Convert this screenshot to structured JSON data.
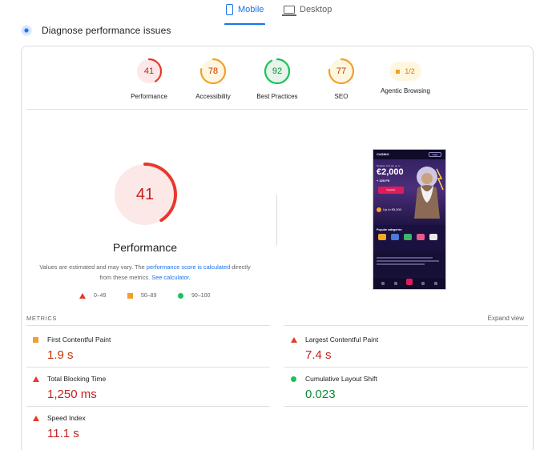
{
  "tabs": [
    {
      "label": "Mobile",
      "icon": "phone-icon",
      "active": true
    },
    {
      "label": "Desktop",
      "icon": "desktop-icon",
      "active": false
    }
  ],
  "diagnose": {
    "title": "Diagnose performance issues"
  },
  "scores": [
    {
      "label": "Performance",
      "value": "41",
      "color": "#e8382e",
      "fill": 0.41
    },
    {
      "label": "Accessibility",
      "value": "78",
      "color": "#f0a030",
      "fill": 0.78
    },
    {
      "label": "Best Practices",
      "value": "92",
      "color": "#19c25a",
      "fill": 0.92
    },
    {
      "label": "SEO",
      "value": "77",
      "color": "#f0a030",
      "fill": 0.77
    },
    {
      "label": "Agentic Browsing",
      "value": "1/2",
      "color": "#f0a030"
    }
  ],
  "main_gauge": {
    "value": "41",
    "fill": 0.41,
    "title": "Performance",
    "color": "#e8382e"
  },
  "note": {
    "part1": "Values are estimated and may vary. The ",
    "link1": "performance score is calculated",
    "part2": " directly from these metrics. ",
    "link2": "See calculator."
  },
  "legend": [
    {
      "range": "0–49",
      "shape": "triangle",
      "color": "#e8382e"
    },
    {
      "range": "50–89",
      "shape": "square",
      "color": "#f0a030"
    },
    {
      "range": "90–100",
      "shape": "circle",
      "color": "#19c25a"
    }
  ],
  "preview": {
    "logo": "CASINO",
    "login": "Login",
    "register_text": "Register and get up to",
    "amount": "€2,000",
    "free_spins": "+ 225 FS",
    "button": "Register",
    "up_to": "Up to €5,000",
    "categories_title": "Popular categories"
  },
  "metrics": {
    "heading": "METRICS",
    "expand": "Expand view",
    "items": [
      {
        "name": "First Contentful Paint",
        "value": "1.9 s",
        "status": "average",
        "color": "#c33300"
      },
      {
        "name": "Largest Contentful Paint",
        "value": "7.4 s",
        "status": "fail",
        "color": "#c5221f"
      },
      {
        "name": "Total Blocking Time",
        "value": "1,250 ms",
        "status": "fail",
        "color": "#c5221f"
      },
      {
        "name": "Cumulative Layout Shift",
        "value": "0.023",
        "status": "pass",
        "color": "#0d8a33"
      },
      {
        "name": "Speed Index",
        "value": "11.1 s",
        "status": "fail",
        "color": "#c5221f"
      }
    ]
  }
}
